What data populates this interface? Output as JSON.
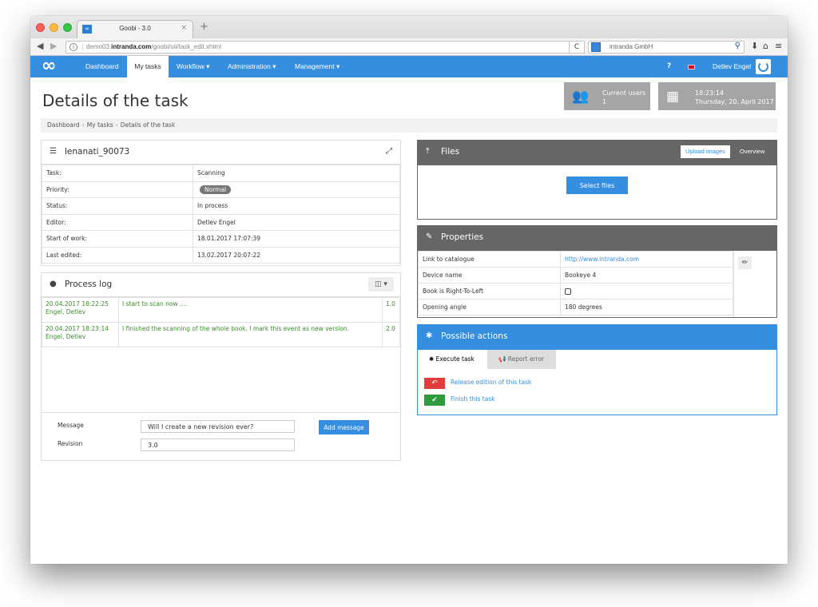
{
  "browser": {
    "tab_title": "Goobi - 3.0",
    "tab_favicon": "goobi-favicon",
    "new_tab_label": "+",
    "url_host": "demo03.",
    "url_domain": "intranda.com",
    "url_path": "/goobi/uii/task_edit.xhtml",
    "search_placeholder": "intranda GmbH"
  },
  "nav": {
    "logo": "∞",
    "items": [
      {
        "label": "Dashboard",
        "active": false
      },
      {
        "label": "My tasks",
        "active": true
      },
      {
        "label": "Workflow ▾",
        "active": false
      },
      {
        "label": "Administration ▾",
        "active": false
      },
      {
        "label": "Management ▾",
        "active": false
      }
    ],
    "help": "?",
    "language_flag": "en-flag",
    "user_name": "Detlev Engel"
  },
  "page": {
    "title": "Details of the task",
    "breadcrumb": [
      "Dashboard",
      "My tasks",
      "Details of the task"
    ],
    "breadcrumb_sep": "›"
  },
  "stats": {
    "users_label": "Current users",
    "users_value": "1",
    "time": "18:23:14",
    "date": "Thursday, 20. April 2017"
  },
  "task": {
    "title": "lenanati_90073",
    "rows": [
      {
        "label": "Task:",
        "value": "Scanning"
      },
      {
        "label": "Priority:",
        "value": "Normal",
        "badge": true
      },
      {
        "label": "Status:",
        "value": "In process"
      },
      {
        "label": "Editor:",
        "value": "Detlev Engel"
      },
      {
        "label": "Start of work:",
        "value": "18.01.2017 17:07:39"
      },
      {
        "label": "Last edited:",
        "value": "13.02.2017 20:07:22"
      }
    ]
  },
  "log": {
    "title": "Process log",
    "entries": [
      {
        "date": "20.04.2017 18:22:25",
        "user": "Engel, Detlev",
        "message": "I start to scan now ....",
        "revision": "1.0"
      },
      {
        "date": "20.04.2017 18:23:14",
        "user": "Engel, Detlev",
        "message": "I finished the scanning of the whole book. I mark this event as new version.",
        "revision": "2.0"
      }
    ],
    "form": {
      "message_label": "Message",
      "message_value": "Will I create a new revision ever?",
      "revision_label": "Revision",
      "revision_value": "3.0",
      "add_button": "Add message"
    }
  },
  "files": {
    "title": "Files",
    "tabs": [
      "Upload images",
      "Overview"
    ],
    "select_button": "Select files"
  },
  "properties": {
    "title": "Properties",
    "rows": [
      {
        "label": "Link to catalogue",
        "value": "http://www.intranda.com",
        "type": "link"
      },
      {
        "label": "Device name",
        "value": "Bookeye 4",
        "type": "text"
      },
      {
        "label": "Book is Right-To-Left",
        "value": "",
        "type": "checkbox",
        "checked": false
      },
      {
        "label": "Opening angle",
        "value": "180 degrees",
        "type": "text"
      }
    ]
  },
  "actions": {
    "title": "Possible actions",
    "tabs": [
      "Execute task",
      "Report error"
    ],
    "items": [
      {
        "label": "Release edition of this task",
        "color": "#e23d3d",
        "icon": "undo-icon"
      },
      {
        "label": "Finish this task",
        "color": "#2d9a3b",
        "icon": "check-icon"
      }
    ]
  },
  "colors": {
    "brand": "#368ee0",
    "dark_header": "#666666",
    "log_text": "#3c8c2c",
    "danger": "#e23d3d",
    "success": "#2d9a3b"
  }
}
